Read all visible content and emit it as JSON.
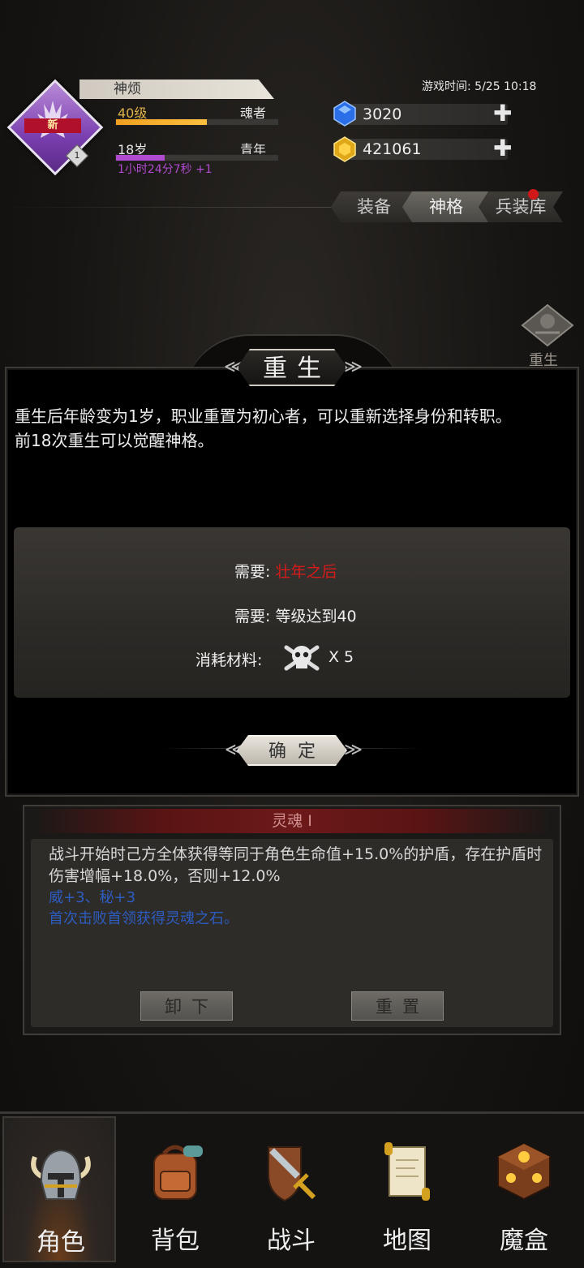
{
  "header": {
    "new_badge": "新",
    "level_badge": "1",
    "name": "神烦",
    "level": "40级",
    "class": "魂者",
    "age": "18岁",
    "life_stage": "青年",
    "age_timer": "1小时24分7秒 +1",
    "game_time": "游戏时间: 5/25 10:18",
    "gems": "3020",
    "gold": "421061",
    "gems_plus": "✚",
    "gold_plus": "✚"
  },
  "tabs": [
    {
      "label": "装备"
    },
    {
      "label": "神格"
    },
    {
      "label": "兵装库"
    }
  ],
  "side_button": {
    "label": "重生"
  },
  "rebirth": {
    "title": "重生",
    "description_1": "重生后年龄变为1岁，职业重置为初心者，可以重新选择身份和转职。",
    "description_2": "前18次重生可以觉醒神格。",
    "req1_prefix": "需要: ",
    "req1_value": "壮年之后",
    "req2": "需要: 等级达到40",
    "cost_label": "消耗材料:",
    "cost_qty": "X 5",
    "confirm": "确定"
  },
  "soul": {
    "title": "灵魂 Ⅰ",
    "desc": "战斗开始时己方全体获得等同于角色生命值+15.0%的护盾，存在护盾时伤害增幅+18.0%，否则+12.0%",
    "bonus": "威+3、秘+3",
    "note": "首次击败首领获得灵魂之石。",
    "unequip": "卸下",
    "reset": "重置"
  },
  "nav": [
    {
      "label": "角色",
      "icon": "helmet-icon"
    },
    {
      "label": "背包",
      "icon": "backpack-icon"
    },
    {
      "label": "战斗",
      "icon": "sword-shield-icon"
    },
    {
      "label": "地图",
      "icon": "scroll-map-icon"
    },
    {
      "label": "魔盒",
      "icon": "magic-box-icon"
    }
  ],
  "progress": {
    "exp_fraction": 0.56,
    "age_fraction": 0.3
  },
  "colors": {
    "accent_gold": "#e0b24a",
    "age_purple": "#b04ad0",
    "requirement_red": "#d81a1a",
    "bonus_blue": "#2d5cc0"
  }
}
